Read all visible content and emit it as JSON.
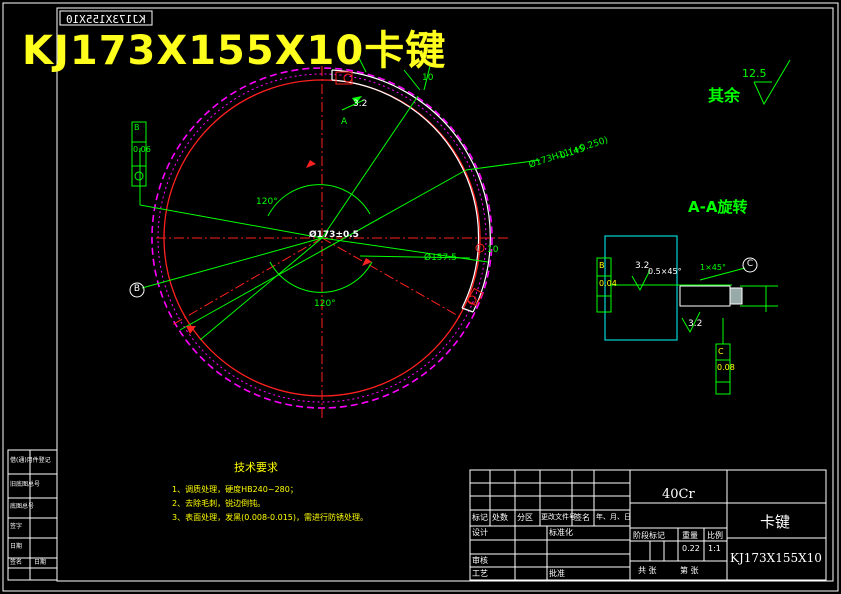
{
  "title": "KJ173X155X10卡键",
  "mirrored_code": "KJ173X155X10",
  "roughness": {
    "value": "12.5",
    "label": "其余"
  },
  "section_label": "A-A旋转",
  "section_marks": [
    "A",
    "A"
  ],
  "angles": [
    "120°",
    "120°"
  ],
  "dims": {
    "outer_dia": "Ø173±0.5",
    "hole_dia": "Ø157.5",
    "dia_tol": "Ø173H11(+0.250)",
    "tol_upper": "-0.145",
    "width": "10",
    "thickness": "10",
    "small_dim": "3.2",
    "chamfer": "0.5×45°",
    "bevel": "1×45°"
  },
  "datums": {
    "b": "B",
    "c": "C"
  },
  "gdt": {
    "circularity": {
      "value": "0.06",
      "datum": "B"
    },
    "flatness": {
      "value": "0.04"
    },
    "parallel": {
      "value": "0.08",
      "datum": "C"
    }
  },
  "tech_req": {
    "heading": "技术要求",
    "items": [
      "1、调质处理，硬度HB240~280；",
      "2、去除毛刺，锐边倒钝。",
      "3、表面处理，发黑(0.008-0.015)，需进行防锈处理。"
    ]
  },
  "title_block": {
    "material": "40Cr",
    "part_name": "卡键",
    "drawing_no": "KJ173X155X10",
    "weight": "0.22",
    "scale": "1:1",
    "labels": {
      "mark": "标记",
      "count": "处数",
      "zone": "分区",
      "change_doc": "更改文件号",
      "signature": "签名",
      "date": "年、月、日",
      "design": "设计",
      "standardize": "标准化",
      "stage_mark": "阶段标记",
      "weight": "重量",
      "scale": "比例",
      "review": "审核",
      "process": "工艺",
      "approve": "批准",
      "total_sheets": "共  张",
      "sheet": "第  张"
    }
  },
  "left_strip": [
    "借(通)用件登记",
    "旧底图总号",
    "底图总号",
    "签字",
    "日期",
    "签名",
    "日期"
  ]
}
